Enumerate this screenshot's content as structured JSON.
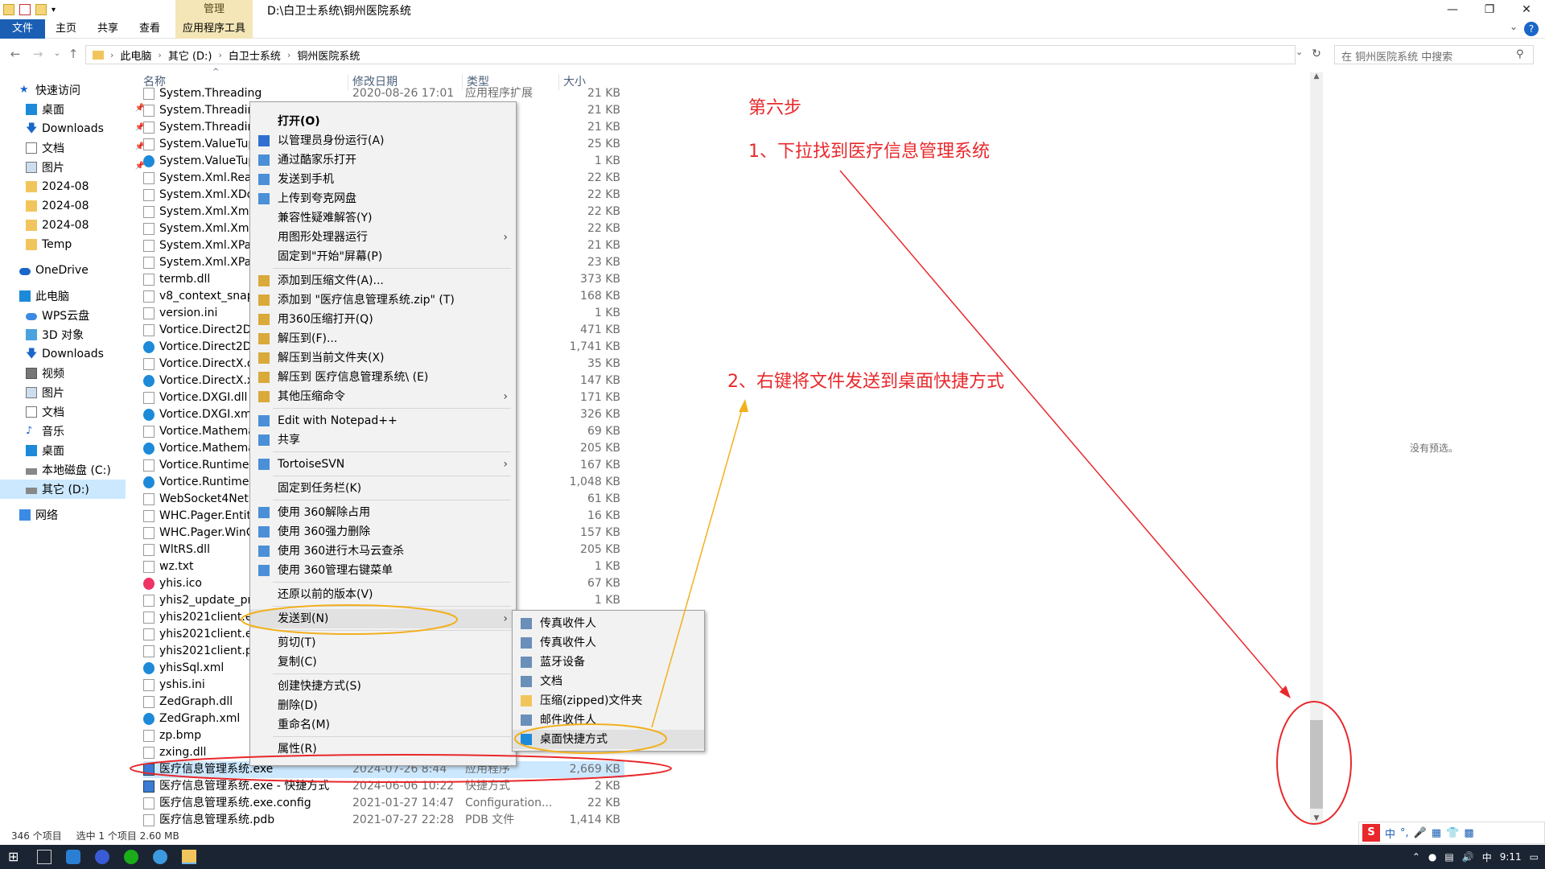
{
  "window": {
    "title": "D:\\白卫士系统\\铜州医院系统",
    "context_group": "管理",
    "buttons": [
      "—",
      "❐",
      "✕"
    ]
  },
  "ribbon": {
    "tabs": [
      "文件",
      "主页",
      "共享",
      "查看",
      "应用程序工具"
    ],
    "help": "?"
  },
  "address": {
    "crumbs": [
      "此电脑",
      "其它 (D:)",
      "白卫士系统",
      "铜州医院系统"
    ],
    "search_placeholder": "在 铜州医院系统 中搜索"
  },
  "nav": {
    "quick_access": "快速访问",
    "items": [
      {
        "label": "桌面",
        "icon": "desktop-icon",
        "pinned": true
      },
      {
        "label": "Downloads",
        "icon": "download-icon",
        "pinned": true
      },
      {
        "label": "文档",
        "icon": "document-icon",
        "pinned": true
      },
      {
        "label": "图片",
        "icon": "picture-icon",
        "pinned": true
      },
      {
        "label": "2024-08",
        "icon": "folder-icon",
        "pinned": false
      },
      {
        "label": "2024-08",
        "icon": "folder-icon",
        "pinned": false
      },
      {
        "label": "2024-08",
        "icon": "folder-icon",
        "pinned": false
      },
      {
        "label": "Temp",
        "icon": "folder-icon",
        "pinned": false
      }
    ],
    "onedrive": "OneDrive",
    "this_pc": "此电脑",
    "pc_items": [
      {
        "label": "WPS云盘",
        "icon": "cloud-icon"
      },
      {
        "label": "3D 对象",
        "icon": "cube-icon"
      },
      {
        "label": "Downloads",
        "icon": "download-icon"
      },
      {
        "label": "视频",
        "icon": "video-icon"
      },
      {
        "label": "图片",
        "icon": "picture-icon"
      },
      {
        "label": "文档",
        "icon": "document-icon"
      },
      {
        "label": "音乐",
        "icon": "music-icon"
      },
      {
        "label": "桌面",
        "icon": "desktop-icon"
      },
      {
        "label": "本地磁盘 (C:)",
        "icon": "drive-icon"
      },
      {
        "label": "其它 (D:)",
        "icon": "drive-icon"
      }
    ],
    "network": "网络"
  },
  "columns": [
    "名称",
    "修改日期",
    "类型",
    "大小"
  ],
  "files": [
    {
      "name": "System.Threading.Thread.dll",
      "date": "2020-08-26 17:01",
      "type": "应用程序扩展",
      "size": "21 KB",
      "icon": "dll"
    },
    {
      "name": "System.Threading",
      "date": "",
      "type": "扩展",
      "size": "21 KB",
      "icon": "dll"
    },
    {
      "name": "System.Threading",
      "date": "",
      "type": "扩展",
      "size": "21 KB",
      "icon": "dll"
    },
    {
      "name": "System.ValueTup",
      "date": "",
      "type": "扩展",
      "size": "25 KB",
      "icon": "dll"
    },
    {
      "name": "System.ValueTup",
      "date": "",
      "type": "t Edg...",
      "size": "1 KB",
      "icon": "edge"
    },
    {
      "name": "System.Xml.Read",
      "date": "",
      "type": "扩展",
      "size": "22 KB",
      "icon": "dll"
    },
    {
      "name": "System.Xml.XDoc",
      "date": "",
      "type": "扩展",
      "size": "22 KB",
      "icon": "dll"
    },
    {
      "name": "System.Xml.XmlD",
      "date": "",
      "type": "扩展",
      "size": "22 KB",
      "icon": "dll"
    },
    {
      "name": "System.Xml.XmlS",
      "date": "",
      "type": "扩展",
      "size": "22 KB",
      "icon": "dll"
    },
    {
      "name": "System.Xml.XPat",
      "date": "",
      "type": "扩展",
      "size": "21 KB",
      "icon": "dll"
    },
    {
      "name": "System.Xml.XPat",
      "date": "",
      "type": "扩展",
      "size": "23 KB",
      "icon": "dll"
    },
    {
      "name": "termb.dll",
      "date": "",
      "type": "扩展",
      "size": "373 KB",
      "icon": "dll"
    },
    {
      "name": "v8_context_snaps",
      "date": "",
      "type": "",
      "size": "168 KB",
      "icon": "file"
    },
    {
      "name": "version.ini",
      "date": "",
      "type": "",
      "size": "1 KB",
      "icon": "file"
    },
    {
      "name": "Vortice.Direct2D",
      "date": "",
      "type": "扩展",
      "size": "471 KB",
      "icon": "dll"
    },
    {
      "name": "Vortice.Direct2D",
      "date": "",
      "type": "t Edg...",
      "size": "1,741 KB",
      "icon": "edge"
    },
    {
      "name": "Vortice.DirectX.d",
      "date": "",
      "type": "扩展",
      "size": "35 KB",
      "icon": "dll"
    },
    {
      "name": "Vortice.DirectX.x",
      "date": "",
      "type": "t Edg...",
      "size": "147 KB",
      "icon": "edge"
    },
    {
      "name": "Vortice.DXGI.dll",
      "date": "",
      "type": "扩展",
      "size": "171 KB",
      "icon": "dll"
    },
    {
      "name": "Vortice.DXGI.xml",
      "date": "",
      "type": "t Edg...",
      "size": "326 KB",
      "icon": "edge"
    },
    {
      "name": "Vortice.Mathema",
      "date": "",
      "type": "扩展",
      "size": "69 KB",
      "icon": "dll"
    },
    {
      "name": "Vortice.Mathema",
      "date": "",
      "type": "t Edg...",
      "size": "205 KB",
      "icon": "edge"
    },
    {
      "name": "Vortice.Runtime.",
      "date": "",
      "type": "扩展",
      "size": "167 KB",
      "icon": "dll"
    },
    {
      "name": "Vortice.Runtime.",
      "date": "",
      "type": "t Edg...",
      "size": "1,048 KB",
      "icon": "edge"
    },
    {
      "name": "WebSocket4Net.",
      "date": "",
      "type": "扩展",
      "size": "61 KB",
      "icon": "dll"
    },
    {
      "name": "WHC.Pager.Entity",
      "date": "",
      "type": "扩展",
      "size": "16 KB",
      "icon": "dll"
    },
    {
      "name": "WHC.Pager.WinC",
      "date": "",
      "type": "扩展",
      "size": "157 KB",
      "icon": "dll"
    },
    {
      "name": "WltRS.dll",
      "date": "",
      "type": "扩展",
      "size": "205 KB",
      "icon": "dll"
    },
    {
      "name": "wz.txt",
      "date": "",
      "type": "",
      "size": "1 KB",
      "icon": "file"
    },
    {
      "name": "yhis.ico",
      "date": "",
      "type": "",
      "size": "67 KB",
      "icon": "ico"
    },
    {
      "name": "yhis2_update_pro",
      "date": "",
      "type": "",
      "size": "1 KB",
      "icon": "file"
    },
    {
      "name": "yhis2021client.ex",
      "date": "",
      "type": "",
      "size": "",
      "icon": "file"
    },
    {
      "name": "yhis2021client.ex",
      "date": "",
      "type": "",
      "size": "",
      "icon": "gear"
    },
    {
      "name": "yhis2021client.pd",
      "date": "",
      "type": "",
      "size": "",
      "icon": "file"
    },
    {
      "name": "yhisSql.xml",
      "date": "",
      "type": "",
      "size": "",
      "icon": "edge"
    },
    {
      "name": "yshis.ini",
      "date": "",
      "type": "",
      "size": "",
      "icon": "gear"
    },
    {
      "name": "ZedGraph.dll",
      "date": "",
      "type": "",
      "size": "",
      "icon": "dll"
    },
    {
      "name": "ZedGraph.xml",
      "date": "",
      "type": "",
      "size": "",
      "icon": "edge"
    },
    {
      "name": "zp.bmp",
      "date": "",
      "type": "",
      "size": "",
      "icon": "file"
    },
    {
      "name": "zxing.dll",
      "date": "",
      "type": "",
      "size": "",
      "icon": "dll"
    },
    {
      "name": "医疗信息管理系统.exe",
      "date": "2024-07-26 8:44",
      "type": "应用程序",
      "size": "2,669 KB",
      "icon": "app",
      "selected": true
    },
    {
      "name": "医疗信息管理系统.exe - 快捷方式",
      "date": "2024-06-06 10:22",
      "type": "快捷方式",
      "size": "2 KB",
      "icon": "app"
    },
    {
      "name": "医疗信息管理系统.exe.config",
      "date": "2021-01-27 14:47",
      "type": "Configuration...",
      "size": "22 KB",
      "icon": "file"
    },
    {
      "name": "医疗信息管理系统.pdb",
      "date": "2021-07-27 22:28",
      "type": "PDB 文件",
      "size": "1,414 KB",
      "icon": "file"
    }
  ],
  "context_menu": [
    {
      "label": "打开(O)",
      "bold": true,
      "icon": ""
    },
    {
      "label": "以管理员身份运行(A)",
      "icon": "shield-icon"
    },
    {
      "label": "通过酷家乐打开",
      "icon": "app-icon"
    },
    {
      "label": "发送到手机",
      "icon": "phone-icon"
    },
    {
      "label": "上传到夸克网盘",
      "icon": "cloud-upload-icon"
    },
    {
      "label": "兼容性疑难解答(Y)",
      "icon": ""
    },
    {
      "label": "用图形处理器运行",
      "icon": "",
      "submenu": true
    },
    {
      "label": "固定到\"开始\"屏幕(P)",
      "icon": ""
    },
    {
      "sep": true
    },
    {
      "label": "添加到压缩文件(A)...",
      "icon": "archive-icon"
    },
    {
      "label": "添加到 \"医疗信息管理系统.zip\" (T)",
      "icon": "archive-icon"
    },
    {
      "label": "用360压缩打开(Q)",
      "icon": "archive-icon"
    },
    {
      "label": "解压到(F)...",
      "icon": "archive-icon"
    },
    {
      "label": "解压到当前文件夹(X)",
      "icon": "archive-icon"
    },
    {
      "label": "解压到 医疗信息管理系统\\ (E)",
      "icon": "archive-icon"
    },
    {
      "label": "其他压缩命令",
      "icon": "archive-icon",
      "submenu": true
    },
    {
      "sep": true
    },
    {
      "label": "Edit with Notepad++",
      "icon": "notepad-icon"
    },
    {
      "label": "共享",
      "icon": "share-icon"
    },
    {
      "sep": true
    },
    {
      "label": "TortoiseSVN",
      "icon": "svn-icon",
      "submenu": true
    },
    {
      "sep": true
    },
    {
      "label": "固定到任务栏(K)",
      "icon": ""
    },
    {
      "sep": true
    },
    {
      "label": "使用 360解除占用",
      "icon": "unlock-icon"
    },
    {
      "label": "使用 360强力删除",
      "icon": "delete-icon"
    },
    {
      "label": "使用 360进行木马云查杀",
      "icon": "scan-icon"
    },
    {
      "label": "使用 360管理右键菜单",
      "icon": "scan-icon"
    },
    {
      "sep": true
    },
    {
      "label": "还原以前的版本(V)",
      "icon": ""
    },
    {
      "sep": true
    },
    {
      "label": "发送到(N)",
      "icon": "",
      "submenu": true,
      "highlight": true
    },
    {
      "sep": true
    },
    {
      "label": "剪切(T)",
      "icon": ""
    },
    {
      "label": "复制(C)",
      "icon": ""
    },
    {
      "sep": true
    },
    {
      "label": "创建快捷方式(S)",
      "icon": ""
    },
    {
      "label": "删除(D)",
      "icon": ""
    },
    {
      "label": "重命名(M)",
      "icon": ""
    },
    {
      "sep": true
    },
    {
      "label": "属性(R)",
      "icon": ""
    }
  ],
  "send_to_menu": [
    {
      "label": "传真收件人",
      "icon": "fax-icon"
    },
    {
      "label": "传真收件人",
      "icon": "fax-icon"
    },
    {
      "label": "蓝牙设备",
      "icon": "bluetooth-icon"
    },
    {
      "label": "文档",
      "icon": "document-icon"
    },
    {
      "label": "压缩(zipped)文件夹",
      "icon": "zip-folder-icon"
    },
    {
      "label": "邮件收件人",
      "icon": "mail-icon"
    },
    {
      "label": "桌面快捷方式",
      "icon": "desktop-icon",
      "highlight": true
    }
  ],
  "preview_text": "没有预选。",
  "status": {
    "count": "346 个项目",
    "selected": "选中 1 个项目  2.60 MB"
  },
  "annotations": {
    "step": "第六步",
    "step1": "1、下拉找到医疗信息管理系统",
    "step2": "2、右键将文件发送到桌面快捷方式"
  },
  "taskbar": {
    "time": "9:11",
    "ime": "中",
    "colors": {
      "bar": "#1b2433",
      "accent": "#1a5fb4",
      "annotation": "#e8282b",
      "highlight_ring": "#f2b01e"
    }
  }
}
